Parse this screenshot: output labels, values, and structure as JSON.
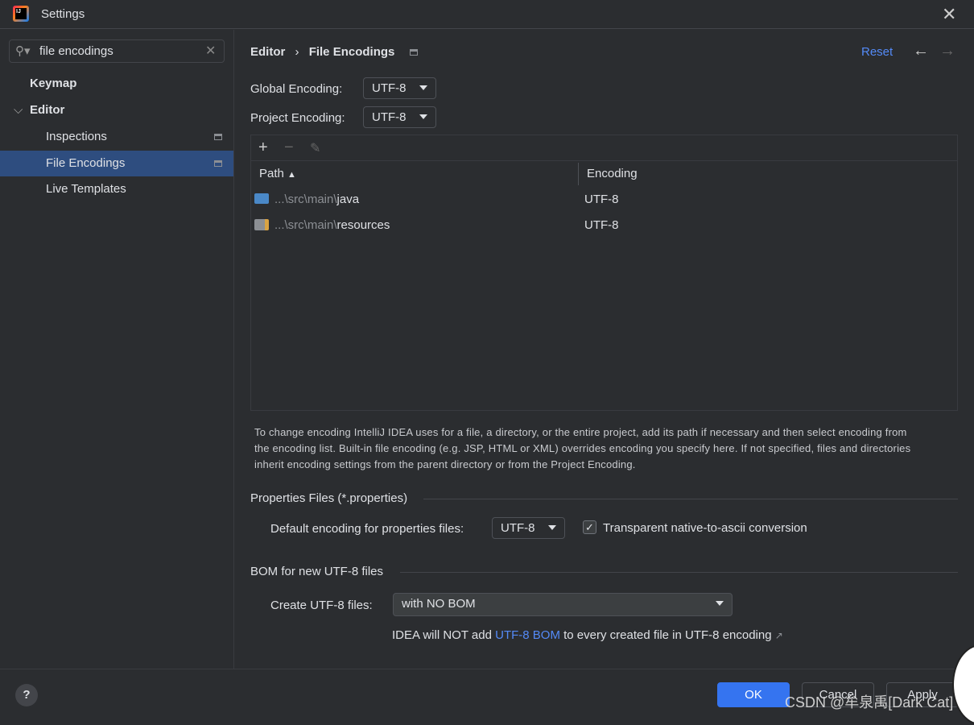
{
  "window": {
    "title": "Settings",
    "close_icon": "close-icon"
  },
  "sidebar": {
    "search_value": "file encodings",
    "items": [
      {
        "label": "Keymap"
      },
      {
        "label": "Editor"
      },
      {
        "label": "Inspections"
      },
      {
        "label": "File Encodings",
        "selected": true
      },
      {
        "label": "Live Templates"
      }
    ]
  },
  "header": {
    "breadcrumb": [
      "Editor",
      "File Encodings"
    ],
    "separator": "›",
    "reset": "Reset"
  },
  "global_encoding": {
    "label": "Global Encoding:",
    "value": "UTF-8"
  },
  "project_encoding": {
    "label": "Project Encoding:",
    "value": "UTF-8"
  },
  "table": {
    "columns": [
      "Path",
      "Encoding"
    ],
    "rows": [
      {
        "prefix": "...\\src\\main\\",
        "name": "java",
        "encoding": "UTF-8"
      },
      {
        "prefix": "...\\src\\main\\",
        "name": "resources",
        "encoding": "UTF-8"
      }
    ]
  },
  "help_text": "To change encoding IntelliJ IDEA uses for a file, a directory, or the entire project, add its path if necessary and then select encoding from the encoding list. Built-in file encoding (e.g. JSP, HTML or XML) overrides encoding you specify here. If not specified, files and directories inherit encoding settings from the parent directory or from the Project Encoding.",
  "properties": {
    "section": "Properties Files (*.properties)",
    "label": "Default encoding for properties files:",
    "value": "UTF-8",
    "checkbox_label": "Transparent native-to-ascii conversion",
    "checked": true
  },
  "bom": {
    "section": "BOM for new UTF-8 files",
    "label": "Create UTF-8 files:",
    "value": "with NO BOM",
    "note_pre": "IDEA will NOT add ",
    "note_link": "UTF-8 BOM",
    "note_post": " to every created file in UTF-8 encoding"
  },
  "footer": {
    "ok": "OK",
    "cancel": "Cancel",
    "apply": "Apply"
  },
  "watermark": "CSDN @牟泉禹[Dark Cat]",
  "colors": {
    "accent": "#3574f0",
    "link": "#548af7",
    "selection": "#2e4d7f"
  }
}
